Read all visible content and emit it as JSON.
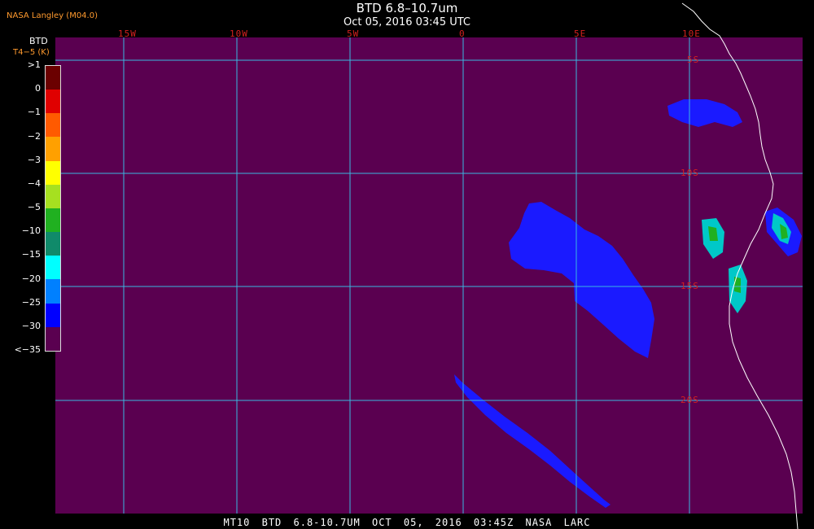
{
  "provider": "NASA Langley (M04.0)",
  "title": "BTD 6.8–10.7um",
  "subtitle": "Oct 05, 2016 03:45 UTC",
  "footer": "MT10  BTD 6.8-10.7UM  OCT 05, 2016 03:45Z  NASA LARC",
  "legend": {
    "title_line1": "BTD",
    "title_line2": "T4−5 (K)",
    "ticks": [
      ">1",
      "0",
      "−1",
      "−2",
      "−3",
      "−4",
      "−5",
      "−10",
      "−15",
      "−20",
      "−25",
      "−30",
      "<−35"
    ],
    "colors": [
      "#6b0000",
      "#e00000",
      "#ff5a00",
      "#ffa000",
      "#ffff00",
      "#a6e020",
      "#20b020",
      "#108a6a",
      "#00ffff",
      "#0080ff",
      "#0000ff",
      "#5a0050"
    ]
  },
  "map": {
    "background": "#5a0050",
    "grid_color": "#3ab8e0",
    "coast_color": "#ffffff",
    "longitude_labels": [
      "15W",
      "10W",
      "5W",
      "0",
      "5E",
      "10E"
    ],
    "latitude_labels": [
      "5S",
      "10S",
      "15S",
      "20S"
    ]
  }
}
